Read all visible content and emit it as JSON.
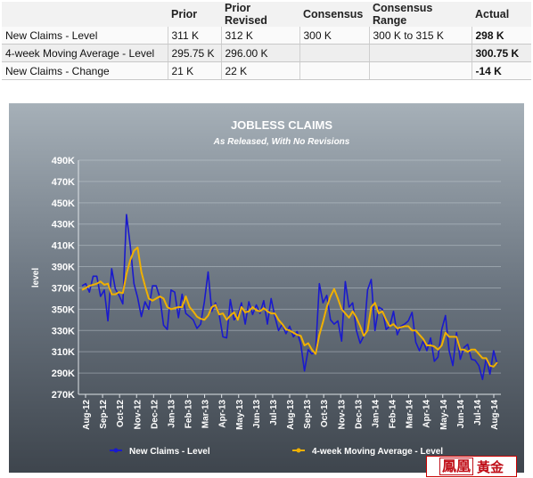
{
  "table": {
    "headers": [
      "",
      "Prior",
      "Prior Revised",
      "Consensus",
      "Consensus Range",
      "Actual"
    ],
    "rows": [
      {
        "label": "New Claims - Level",
        "prior": "311 K",
        "prior_revised": "312 K",
        "consensus": "300 K",
        "range": "300 K to 315 K",
        "actual": "298 K"
      },
      {
        "label": "4-week Moving Average - Level",
        "prior": "295.75 K",
        "prior_revised": "296.00 K",
        "consensus": "",
        "range": "",
        "actual": "300.75 K"
      },
      {
        "label": "New Claims - Change",
        "prior": "21 K",
        "prior_revised": "22 K",
        "consensus": "",
        "range": "",
        "actual": "-14 K"
      }
    ]
  },
  "chart_data": {
    "type": "line",
    "title": "JOBLESS CLAIMS",
    "subtitle": "As Released, With No Revisions",
    "ylabel": "level",
    "ylim": [
      270,
      490
    ],
    "yticks": [
      "270K",
      "290K",
      "310K",
      "330K",
      "350K",
      "370K",
      "390K",
      "410K",
      "430K",
      "450K",
      "470K",
      "490K"
    ],
    "xticks": [
      "Aug-12",
      "Sep-12",
      "Oct-12",
      "Nov-12",
      "Dec-12",
      "Jan-13",
      "Feb-13",
      "Mar-13",
      "Apr-13",
      "May-13",
      "Jun-13",
      "Jul-13",
      "Aug-13",
      "Sep-13",
      "Oct-13",
      "Nov-13",
      "Dec-13",
      "Jan-14",
      "Feb-14",
      "Mar-14",
      "Apr-14",
      "May-14",
      "Jun-14",
      "Jul-14",
      "Aug-14"
    ],
    "grid": true,
    "legend_position": "bottom",
    "series": [
      {
        "name": "New Claims - Level",
        "color": "#1a1acc",
        "values": [
          372,
          374,
          366,
          381,
          381,
          362,
          368,
          339,
          388,
          369,
          363,
          355,
          439,
          410,
          374,
          361,
          343,
          357,
          350,
          372,
          372,
          361,
          335,
          331,
          368,
          366,
          342,
          364,
          346,
          343,
          340,
          332,
          336,
          357,
          385,
          348,
          356,
          345,
          324,
          323,
          359,
          340,
          344,
          356,
          336,
          357,
          345,
          354,
          346,
          358,
          336,
          360,
          343,
          330,
          336,
          327,
          334,
          324,
          329,
          317,
          292,
          312,
          308,
          310,
          374,
          356,
          363,
          340,
          336,
          339,
          320,
          376,
          352,
          356,
          330,
          318,
          325,
          368,
          378,
          330,
          352,
          350,
          331,
          334,
          348,
          326,
          334,
          336,
          339,
          347,
          319,
          311,
          320,
          311,
          323,
          301,
          305,
          331,
          344,
          311,
          297,
          328,
          303,
          314,
          317,
          303,
          302,
          297,
          284,
          304,
          289,
          311,
          298
        ]
      },
      {
        "name": "4-week Moving Average - Level",
        "color": "#f0b000",
        "values": [
          368,
          370,
          372,
          373,
          374,
          376,
          373,
          374,
          364,
          364,
          366,
          365,
          383,
          396,
          405,
          408,
          385,
          372,
          360,
          358,
          360,
          362,
          360,
          352,
          350,
          351,
          352,
          352,
          362,
          352,
          348,
          343,
          341,
          340,
          344,
          352,
          354,
          345,
          346,
          340,
          344,
          347,
          340,
          352,
          347,
          348,
          352,
          349,
          348,
          351,
          348,
          346,
          346,
          340,
          336,
          331,
          330,
          328,
          326,
          325,
          316,
          318,
          312,
          308,
          326,
          338,
          352,
          362,
          369,
          360,
          350,
          346,
          342,
          348,
          342,
          334,
          325,
          330,
          352,
          356,
          346,
          348,
          340,
          334,
          336,
          332,
          333,
          334,
          334,
          330,
          330,
          326,
          322,
          316,
          316,
          315,
          312,
          316,
          328,
          324,
          324,
          324,
          312,
          312,
          310,
          312,
          312,
          308,
          304,
          304,
          297,
          296,
          300
        ]
      }
    ]
  },
  "brand": {
    "mark": "鳳凰",
    "text": "黃金"
  }
}
